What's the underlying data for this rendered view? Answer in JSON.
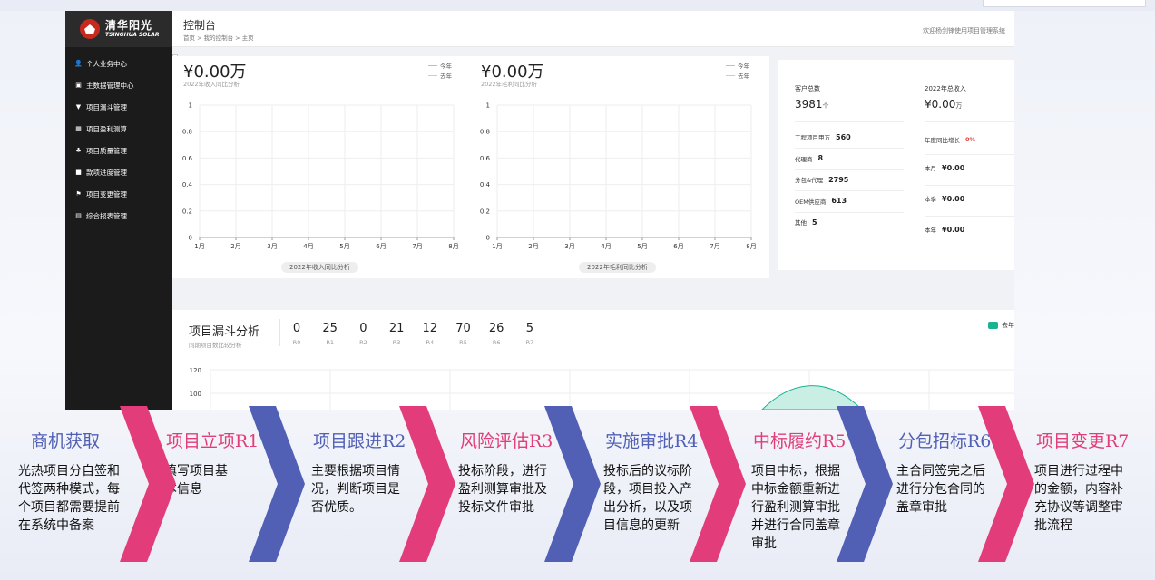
{
  "app": {
    "logo_cn": "清华阳光",
    "logo_en": "TSINGHUA SOLAR",
    "header_title": "控制台",
    "breadcrumb": "首页 > 我的控制台 > 主页",
    "welcome": "欢迎杨剑锋使用项目管理系统"
  },
  "sidebar": {
    "items": [
      {
        "label": "个人业务中心",
        "icon": "user-icon",
        "glyph": "👤"
      },
      {
        "label": "主数据管理中心",
        "icon": "database-icon",
        "glyph": "▣"
      },
      {
        "label": "项目漏斗管理",
        "icon": "funnel-icon",
        "glyph": "▼"
      },
      {
        "label": "项目盈利测算",
        "icon": "calculator-icon",
        "glyph": "▦"
      },
      {
        "label": "项目质量管理",
        "icon": "quality-icon",
        "glyph": "♣"
      },
      {
        "label": "款项进度管理",
        "icon": "folder-icon",
        "glyph": "■"
      },
      {
        "label": "项目变更管理",
        "icon": "flag-icon",
        "glyph": "⚑"
      },
      {
        "label": "综合报表管理",
        "icon": "report-icon",
        "glyph": "▤"
      }
    ]
  },
  "income": {
    "amount": "¥0.00万",
    "subtitle": "2022年收入同比分析",
    "legend_this": "今年",
    "legend_last": "去年",
    "pill": "2022年收入同比分析"
  },
  "profit": {
    "amount": "¥0.00万",
    "subtitle": "2022年毛利同比分析",
    "legend_this": "今年",
    "legend_last": "去年",
    "pill": "2022年毛利同比分析"
  },
  "chart_data": [
    {
      "type": "line",
      "title": "2022年收入同比分析",
      "categories": [
        "1月",
        "2月",
        "3月",
        "4月",
        "5月",
        "6月",
        "7月",
        "8月"
      ],
      "yticks": [
        "0",
        "0.2",
        "0.4",
        "0.6",
        "0.8",
        "1"
      ],
      "ylim": [
        0,
        1
      ],
      "series": [
        {
          "name": "今年",
          "values": [
            0,
            0,
            0,
            0,
            0,
            0,
            0,
            0
          ],
          "color": "#f0b27a"
        },
        {
          "name": "去年",
          "values": [
            0,
            0,
            0,
            0,
            0,
            0,
            0,
            0
          ],
          "color": "#cccccc"
        }
      ]
    },
    {
      "type": "line",
      "title": "2022年毛利同比分析",
      "categories": [
        "1月",
        "2月",
        "3月",
        "4月",
        "5月",
        "6月",
        "7月",
        "8月"
      ],
      "yticks": [
        "0",
        "0.2",
        "0.4",
        "0.6",
        "0.8",
        "1"
      ],
      "ylim": [
        0,
        1
      ],
      "series": [
        {
          "name": "今年",
          "values": [
            0,
            0,
            0,
            0,
            0,
            0,
            0,
            0
          ],
          "color": "#f0b27a"
        },
        {
          "name": "去年",
          "values": [
            0,
            0,
            0,
            0,
            0,
            0,
            0,
            0
          ],
          "color": "#cccccc"
        }
      ]
    }
  ],
  "stats": {
    "customers_label": "客户总数",
    "customers_value": "3981",
    "customers_unit": "个",
    "income_label": "2022年总收入",
    "income_value": "¥0.00",
    "income_unit": "万",
    "rows_left": [
      {
        "label": "工程项目甲方",
        "value": "560"
      },
      {
        "label": "代理商",
        "value": "8"
      },
      {
        "label": "分包&代理",
        "value": "2795"
      },
      {
        "label": "OEM供应商",
        "value": "613"
      },
      {
        "label": "其他",
        "value": "5"
      }
    ],
    "growth_label": "年度同比增长",
    "growth_value": "0%",
    "growth_color": "#e53935",
    "rows_right": [
      {
        "label": "本月",
        "value": "¥0.00"
      },
      {
        "label": "本季",
        "value": "¥0.00"
      },
      {
        "label": "本年",
        "value": "¥0.00"
      }
    ]
  },
  "funnel": {
    "title": "项目漏斗分析",
    "subtitle": "同期项目数比较分析",
    "stages": [
      {
        "k": "R0",
        "v": "0"
      },
      {
        "k": "R1",
        "v": "25"
      },
      {
        "k": "R2",
        "v": "0"
      },
      {
        "k": "R3",
        "v": "21"
      },
      {
        "k": "R4",
        "v": "12"
      },
      {
        "k": "R5",
        "v": "70"
      },
      {
        "k": "R6",
        "v": "26"
      },
      {
        "k": "R7",
        "v": "5"
      }
    ],
    "legend": "去年",
    "legend_color": "#19b394",
    "yticks": [
      "120",
      "100"
    ]
  },
  "process": [
    {
      "title": "商机获取",
      "desc": "光热项目分自签和代签两种模式，每个项目都需要提前在系统中备案",
      "color": "#5160b5"
    },
    {
      "title": "项目立项R1",
      "desc": "填写项目基本信息",
      "color": "#e23d7a"
    },
    {
      "title": "项目跟进R2",
      "desc": "主要根据项目情况，判断项目是否优质。",
      "color": "#5160b5"
    },
    {
      "title": "风险评估R3",
      "desc": "投标阶段，进行盈利测算审批及投标文件审批",
      "color": "#e23d7a"
    },
    {
      "title": "实施审批R4",
      "desc": "投标后的议标阶段，项目投入产出分析，以及项目信息的更新",
      "color": "#5160b5"
    },
    {
      "title": "中标履约R5",
      "desc": "项目中标，根据中标金额重新进行盈利测算审批并进行合同盖章审批",
      "color": "#e23d7a"
    },
    {
      "title": "分包招标R6",
      "desc": "主合同签完之后进行分包合同的盖章审批",
      "color": "#5160b5"
    },
    {
      "title": "项目变更R7",
      "desc": "项目进行过程中的金额，内容补充协议等调整审批流程",
      "color": "#e23d7a"
    }
  ]
}
